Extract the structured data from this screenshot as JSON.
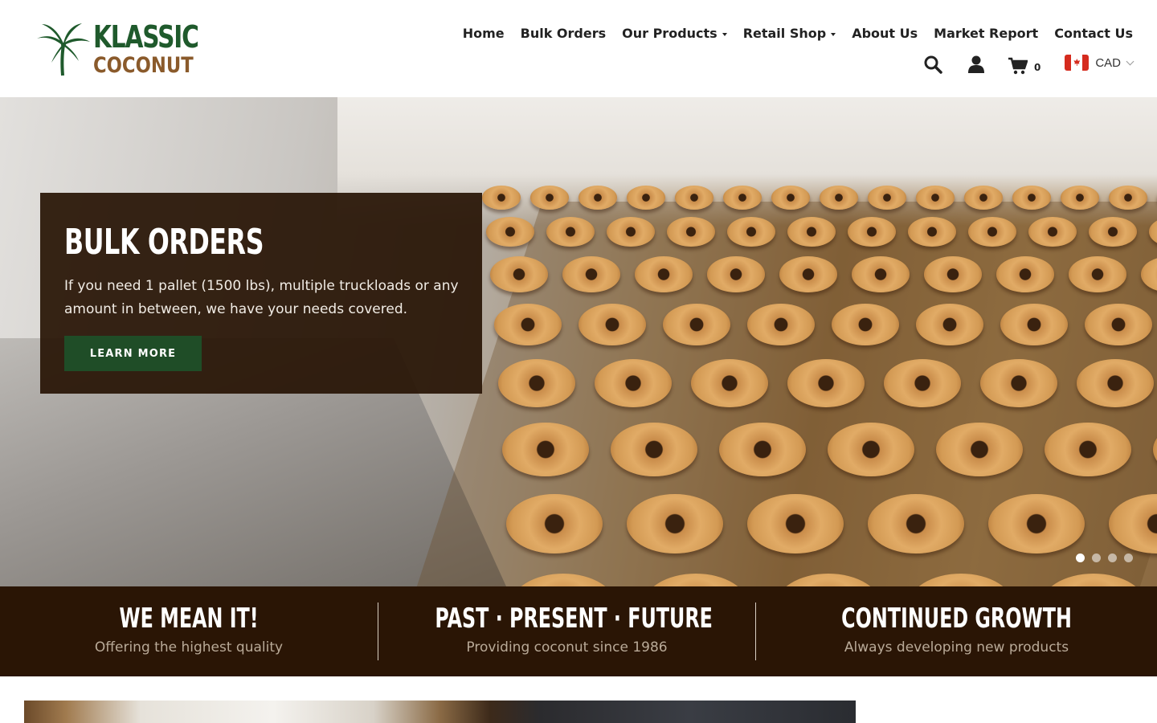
{
  "brand": {
    "line1": "KLASSIC",
    "line2": "COCONUT",
    "colors": {
      "green": "#1f5a2c",
      "brown": "#8a5a2b"
    }
  },
  "nav": {
    "items": [
      {
        "label": "Home",
        "dropdown": false
      },
      {
        "label": "Bulk Orders",
        "dropdown": false
      },
      {
        "label": "Our Products",
        "dropdown": true
      },
      {
        "label": "Retail Shop",
        "dropdown": true
      },
      {
        "label": "About Us",
        "dropdown": false
      },
      {
        "label": "Market Report",
        "dropdown": false
      },
      {
        "label": "Contact Us",
        "dropdown": false
      }
    ]
  },
  "utility": {
    "search_icon": "search-icon",
    "account_icon": "user-icon",
    "cart_icon": "cart-icon",
    "cart_count": "0",
    "currency": "CAD",
    "flag": "canada-flag-icon"
  },
  "hero": {
    "title": "BULK ORDERS",
    "text": "If you need 1 pallet (1500 lbs), multiple truckloads or any amount in between, we have your needs covered.",
    "button": "LEARN MORE",
    "slides_total": 4,
    "active_slide": 1,
    "colors": {
      "panel": "#281405",
      "button": "#1f4d27"
    }
  },
  "features": [
    {
      "title": "WE MEAN IT!",
      "subtitle": "Offering the highest quality"
    },
    {
      "title": "PAST · PRESENT · FUTURE",
      "subtitle": "Providing coconut since 1986"
    },
    {
      "title": "CONTINUED GROWTH",
      "subtitle": "Always developing new products"
    }
  ],
  "theme": {
    "strip_bg": "#2a1505",
    "strip_sub_text": "#b9aa98"
  }
}
